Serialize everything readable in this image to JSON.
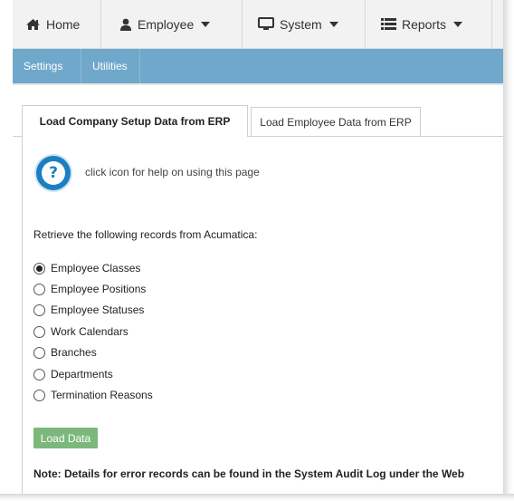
{
  "nav": {
    "home": {
      "label": "Home",
      "icon": "home-icon"
    },
    "employee": {
      "label": "Employee",
      "icon": "user-icon"
    },
    "system": {
      "label": "System",
      "icon": "monitor-icon"
    },
    "reports": {
      "label": "Reports",
      "icon": "list-icon"
    }
  },
  "subnav": {
    "items": [
      {
        "label": "Settings"
      },
      {
        "label": "Utilities"
      }
    ]
  },
  "tabs": [
    {
      "label": "Load Company Setup Data from ERP",
      "active": true
    },
    {
      "label": "Load Employee Data from ERP",
      "active": false
    }
  ],
  "help": {
    "text": "click icon for help on using this page",
    "icon": "help-icon"
  },
  "intro": "Retrieve the following records from Acumatica:",
  "options": [
    {
      "label": "Employee Classes",
      "selected": true
    },
    {
      "label": "Employee Positions",
      "selected": false
    },
    {
      "label": "Employee Statuses",
      "selected": false
    },
    {
      "label": "Work Calendars",
      "selected": false
    },
    {
      "label": "Branches",
      "selected": false
    },
    {
      "label": "Departments",
      "selected": false
    },
    {
      "label": "Termination Reasons",
      "selected": false
    }
  ],
  "load_button": "Load Data",
  "note": "Note: Details for error records can be found in the System Audit Log under the Web",
  "colors": {
    "navbar_bg": "#f2f2f2",
    "subnav_bg": "#6fa8cb",
    "help_blue": "#1b7fc4",
    "button_green": "#7cb87c"
  }
}
